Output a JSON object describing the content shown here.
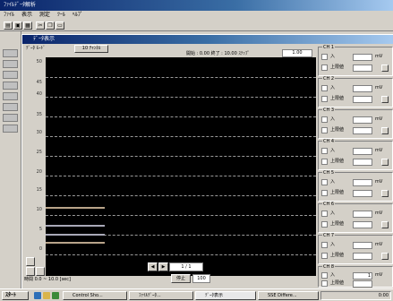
{
  "outer_window": {
    "title": "ﾌｧｲﾙﾃﾞｰﾀ解析",
    "menu": [
      "ﾌｧｲﾙ",
      "表示",
      "測定",
      "ﾂｰﾙ",
      "ﾍﾙﾌﾟ"
    ],
    "toolbar_icons": [
      "open-icon",
      "save-icon",
      "print-icon",
      "cut-icon",
      "copy-icon",
      "paste-icon"
    ]
  },
  "inner_window": {
    "title": "ﾃﾞｰﾀ表示",
    "subheader": "ﾃﾞｰﾀ ﾓｰﾄﾞ",
    "mode_button": "10 ﾁｬﾝﾈﾙ",
    "info_label": "開始 : 0.00  終了 : 10.00  ｽﾃｯﾌﾟ",
    "info_value": "1.00"
  },
  "plot": {
    "y_ticks": [
      "50",
      "45",
      "40",
      "35",
      "30",
      "25",
      "20",
      "15",
      "10",
      "5",
      "0"
    ],
    "x_label": "時間  0.0 ~ 10.0 [sec]",
    "traces_count_label": ""
  },
  "controls": {
    "prev_label": "◀",
    "next_label": "▶",
    "page_value": "1 / 1",
    "stop_label": "停止",
    "zoom_value": "100"
  },
  "channels": [
    {
      "title": "CH 1",
      "row1": "入",
      "row2": "上限値",
      "value1": "",
      "value2": "",
      "unit": "mV"
    },
    {
      "title": "CH 2",
      "row1": "入",
      "row2": "上限値",
      "value1": "",
      "value2": "",
      "unit": "mV"
    },
    {
      "title": "CH 3",
      "row1": "入",
      "row2": "上限値",
      "value1": "",
      "value2": "",
      "unit": "mV"
    },
    {
      "title": "CH 4",
      "row1": "入",
      "row2": "上限値",
      "value1": "",
      "value2": "",
      "unit": "mV"
    },
    {
      "title": "CH 5",
      "row1": "入",
      "row2": "上限値",
      "value1": "",
      "value2": "",
      "unit": "mV"
    },
    {
      "title": "CH 6",
      "row1": "入",
      "row2": "上限値",
      "value1": "",
      "value2": "",
      "unit": "mV"
    },
    {
      "title": "CH 7",
      "row1": "入",
      "row2": "上限値",
      "value1": "",
      "value2": "",
      "unit": "mV"
    },
    {
      "title": "CH 8",
      "row1": "入",
      "row2": "上限値",
      "value1": "",
      "value2": "1",
      "unit": "mV"
    }
  ],
  "taskbar": {
    "start_label": "ｽﾀｰﾄ",
    "tasks": [
      "Control Sho...",
      "ﾌｧｲﾙﾃﾞｰﾀ...",
      "ﾃﾞｰﾀ表示",
      "SSE Differe..."
    ],
    "clock": "0:00"
  },
  "colors": {
    "plot_background": "#000000",
    "trace_tan": "#b9a48a",
    "trace_gray": "#a9a9b8",
    "titlebar": "#0a246a"
  }
}
